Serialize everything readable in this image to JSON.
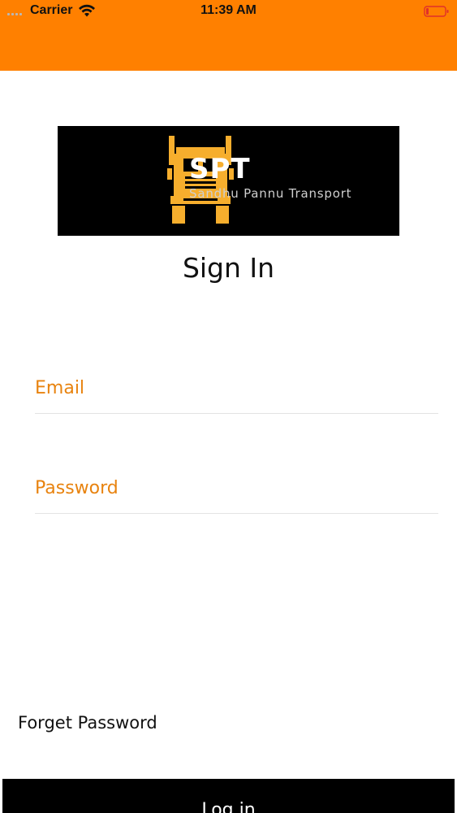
{
  "status_bar": {
    "carrier": "Carrier",
    "time": "11:39 AM",
    "wifi_icon": "wifi-icon",
    "battery_icon": "battery-low-icon",
    "battery_color": "#e0302a"
  },
  "header": {
    "color": "#ff8000"
  },
  "logo": {
    "title": "SPT",
    "subtitle": "Sandhu Pannu Transport",
    "icon": "truck-icon",
    "icon_color": "#f6ae2d"
  },
  "sign_in": {
    "heading": "Sign In"
  },
  "form": {
    "email_placeholder": "Email",
    "email_value": "",
    "password_placeholder": "Password",
    "password_value": "",
    "accent": "#e8830f"
  },
  "links": {
    "forget_password": "Forget Password"
  },
  "actions": {
    "login_label": "Log in"
  }
}
